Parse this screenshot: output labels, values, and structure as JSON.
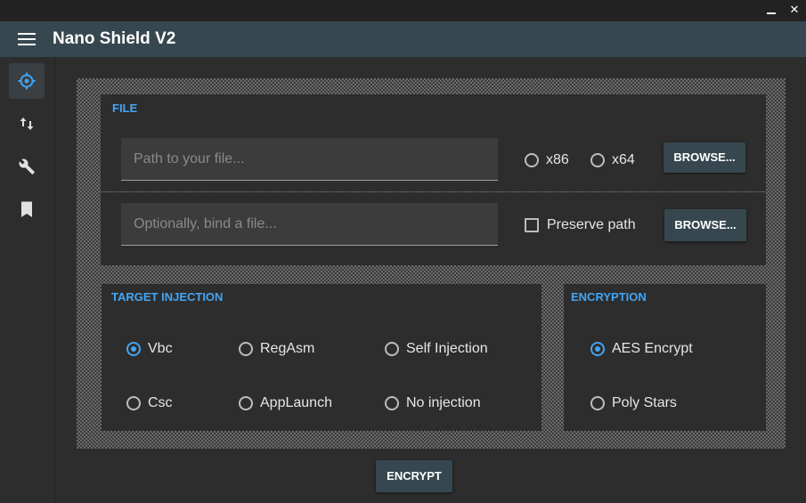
{
  "window": {
    "minimize_icon": "minimize-icon",
    "close_glyph": "✕"
  },
  "appbar": {
    "title": "Nano Shield V2",
    "menu_icon": "hamburger-icon",
    "background": "#37474f"
  },
  "sidebar": {
    "items": [
      {
        "icon": "crosshair-icon",
        "active": true
      },
      {
        "icon": "swap-vertical-icon",
        "active": false
      },
      {
        "icon": "wrench-icon",
        "active": false
      },
      {
        "icon": "bookmark-icon",
        "active": false
      }
    ]
  },
  "file_section": {
    "title": "FILE",
    "path_placeholder": "Path to your file...",
    "bind_placeholder": "Optionally, bind a file...",
    "arch_options": [
      {
        "label": "x86",
        "checked": false
      },
      {
        "label": "x64",
        "checked": false
      }
    ],
    "preserve_path": {
      "label": "Preserve path",
      "checked": false
    },
    "browse_label": "BROWSE...",
    "browse_bind_label": "BROWSE..."
  },
  "injection_section": {
    "title": "TARGET INJECTION",
    "options": [
      {
        "label": "Vbc",
        "checked": true
      },
      {
        "label": "RegAsm",
        "checked": false
      },
      {
        "label": "Self Injection",
        "checked": false
      },
      {
        "label": "Csc",
        "checked": false
      },
      {
        "label": "AppLaunch",
        "checked": false
      },
      {
        "label": "No injection",
        "checked": false
      }
    ]
  },
  "encryption_section": {
    "title": "ENCRYPTION",
    "options": [
      {
        "label": "AES Encrypt",
        "checked": true
      },
      {
        "label": "Poly Stars",
        "checked": false
      }
    ]
  },
  "encrypt_button": {
    "label": "ENCRYPT"
  },
  "colors": {
    "accent": "#42a5f5",
    "primary": "#37474f",
    "background": "#2d2d2d"
  }
}
